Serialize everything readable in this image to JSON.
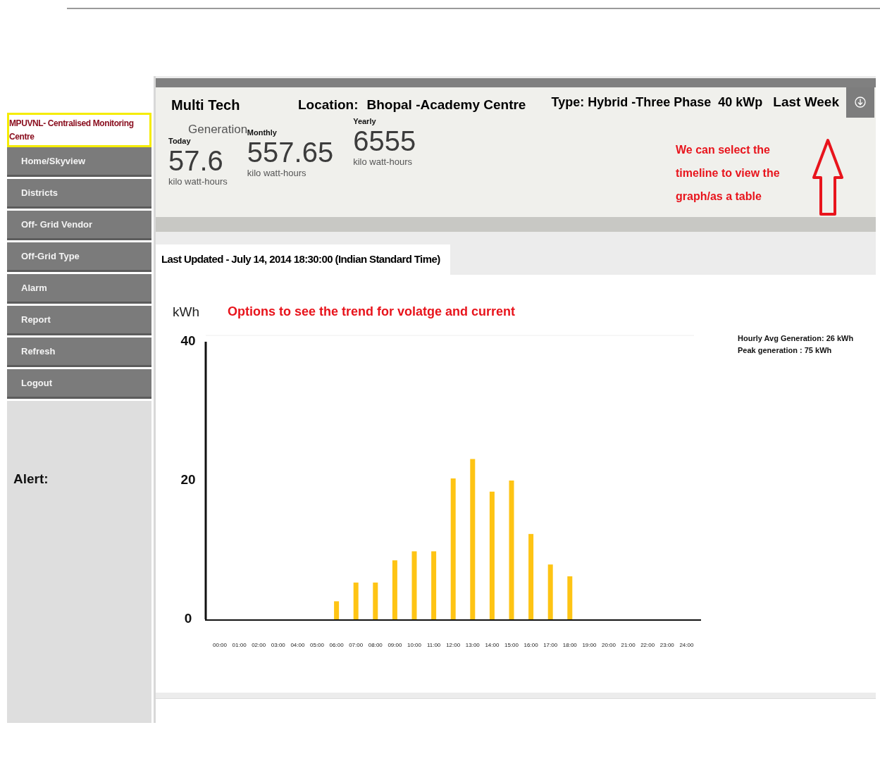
{
  "sidebar": {
    "title": "MPUVNL- Centralised Monitoring Centre",
    "items": [
      "Home/Skyview",
      "Districts",
      "Off- Grid  Vendor",
      "Off-Grid Type",
      "Alarm",
      "Report",
      "Refresh",
      "Logout"
    ],
    "alert_label": "Alert:"
  },
  "site": {
    "name": "Multi Tech",
    "location_label": "Location:",
    "location": "Bhopal -Academy Centre",
    "type": "Type: Hybrid -Three Phase  40 kWp",
    "period": "Last Week"
  },
  "generation": {
    "title": "Generation",
    "metrics": [
      {
        "label": "Today",
        "value": "57.6",
        "unit": "kilo watt-hours"
      },
      {
        "label": "Monthly",
        "value": "557.65",
        "unit": "kilo watt-hours"
      },
      {
        "label": "Yearly",
        "value": "6555",
        "unit": "kilo watt-hours"
      }
    ]
  },
  "timeline_note": "We can select the timeline to view the graph/as a table",
  "last_updated": "Last Updated - July 14, 2014 18:30:00 (Indian Standard Time)",
  "chart": {
    "unit": "kWh",
    "trend_note": "Options to see the trend for volatge and current",
    "stats": [
      "Hourly Avg Generation: 26 kWh",
      "Peak generation : 75 kWh"
    ],
    "chart_data": {
      "type": "bar",
      "categories": [
        "00:00",
        "01:00",
        "02:00",
        "03:00",
        "04:00",
        "05:00",
        "06:00",
        "07:00",
        "08:00",
        "09:00",
        "10:00",
        "11:00",
        "12:00",
        "13:00",
        "14:00",
        "15:00",
        "16:00",
        "17:00",
        "18:00",
        "19:00",
        "20:00",
        "21:00",
        "22:00",
        "23:00",
        "24:00"
      ],
      "series": [
        {
          "color": "#fec414",
          "values": [
            null,
            null,
            null,
            null,
            null,
            null,
            2.6,
            5.3,
            5.3,
            8.5,
            9.8,
            9.8,
            20.3,
            23.1,
            18.4,
            20,
            12.3,
            7.9,
            6.2,
            null,
            null,
            null,
            null,
            null,
            null
          ]
        }
      ],
      "ylim": [
        0,
        40
      ],
      "yticks": [
        0,
        20,
        40
      ]
    }
  }
}
